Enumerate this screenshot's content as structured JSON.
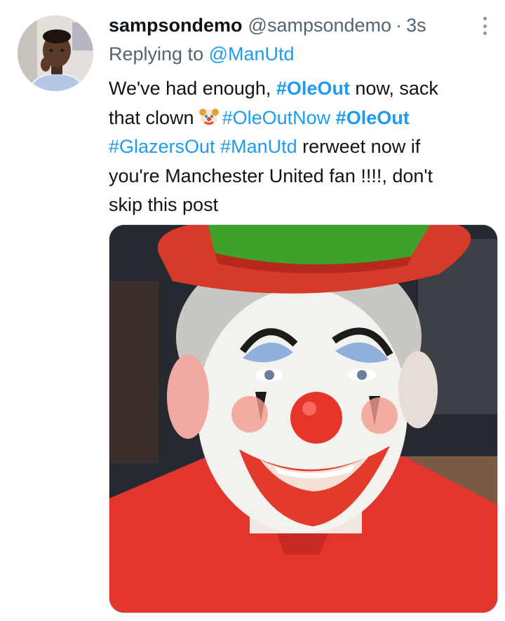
{
  "tweet": {
    "author": {
      "display_name": "sampsondemo",
      "handle": "@sampsondemo",
      "avatar_icon": "user-avatar"
    },
    "separator": "·",
    "time": "3s",
    "more_icon": "more-vertical-icon",
    "reply": {
      "prefix": "Replying to",
      "to": "@ManUtd"
    },
    "text": {
      "l1_a": "We've had enough,  ",
      "l1_tag": "#OleOut",
      "l1_b": " now, sack",
      "l2_a": "that clown",
      "l2_emoji": "clown-face-icon",
      "l2_tag1": "#OleOutNow",
      "l2_tag2": "#OleOut",
      "l3_tag1": "#GlazersOut",
      "l3_tag2": "#ManUtd",
      "l3_b": " rerweet now if",
      "l4": "you're Manchester United fan !!!!, don't",
      "l5": "skip this post"
    },
    "media": {
      "description_icon": "clown-photo"
    },
    "colors": {
      "link": "#1d9bf0",
      "text": "#0f1419",
      "secondary": "#536471"
    }
  }
}
